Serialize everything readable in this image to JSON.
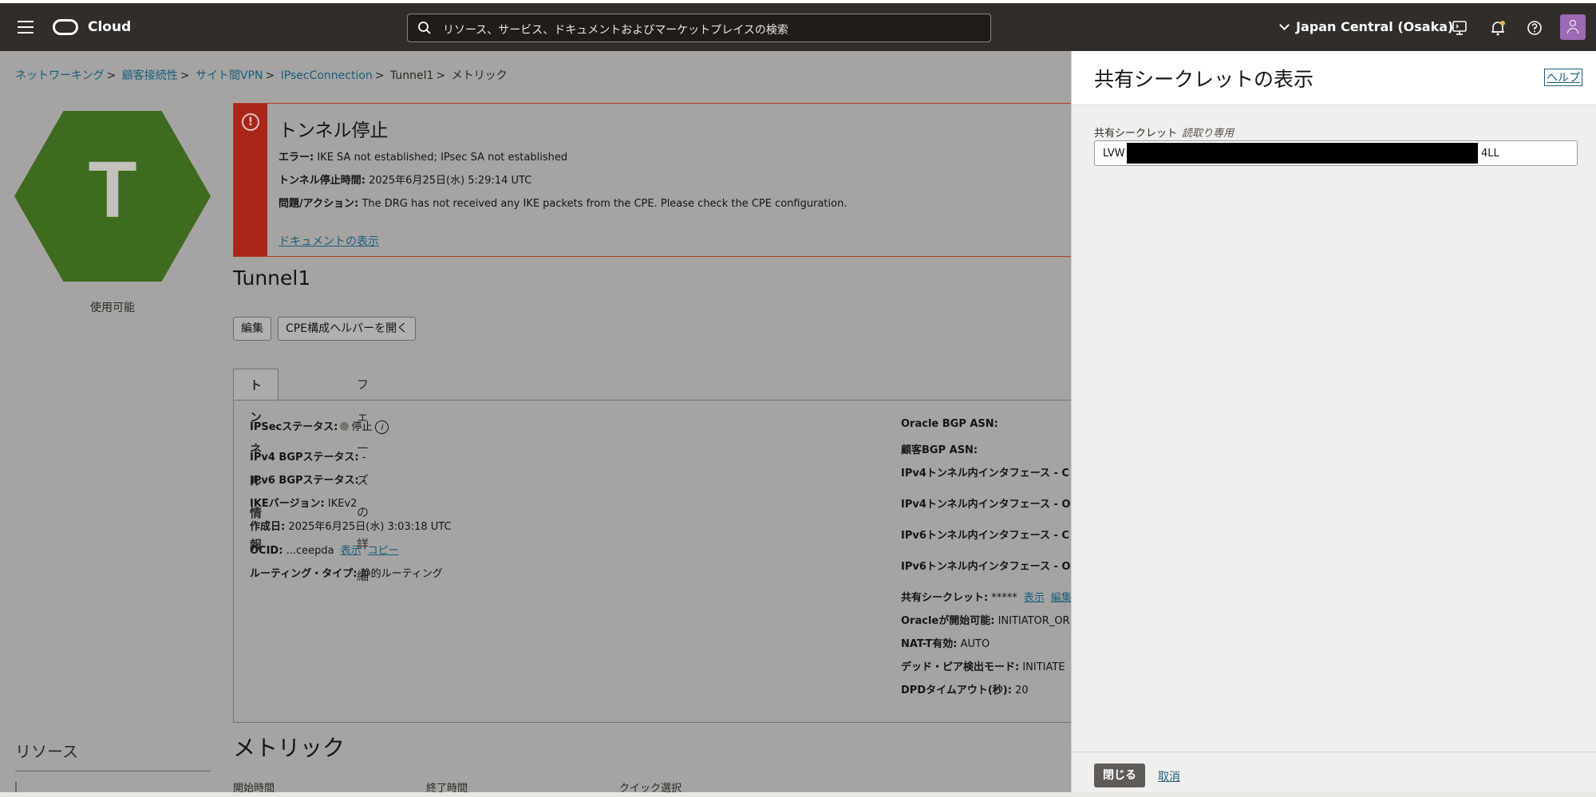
{
  "topbar": {
    "brand": "Cloud",
    "search_placeholder": "リソース、サービス、ドキュメントおよびマーケットプレイスの検索",
    "region": "Japan Central (Osaka)"
  },
  "breadcrumb": {
    "items": [
      "ネットワーキング",
      "顧客接続性",
      "サイト間VPN",
      "IPsecConnection",
      "Tunnel1"
    ],
    "current": "メトリック"
  },
  "resource_icon": {
    "letter": "T",
    "status": "使用可能"
  },
  "alert": {
    "title": "トンネル停止",
    "error_label": "エラー:",
    "error_value": "IKE SA not established; IPsec SA not established",
    "down_time_label": "トンネル停止時間:",
    "down_time_value": "2025年6月25日(水) 5:29:14 UTC",
    "issue_label": "問題/アクション:",
    "issue_value": "The DRG has not received any IKE packets from the CPE. Please check the CPE configuration.",
    "doc_link": "ドキュメントの表示"
  },
  "tunnel": {
    "title": "Tunnel1",
    "edit_label": "編集",
    "cpe_helper_label": "CPE構成ヘルパーを開く",
    "tabs": [
      "トンネル情報",
      "フェーズの詳細"
    ]
  },
  "info_left": {
    "ipsec_status_label": "IPSecステータス:",
    "ipsec_status_value": "停止",
    "ipv4_bgp_label": "IPv4 BGPステータス:",
    "ipv4_bgp_value": "-",
    "ipv6_bgp_label": "IPv6 BGPステータス:",
    "ipv6_bgp_value": "-",
    "ike_label": "IKEバージョン:",
    "ike_value": "IKEv2",
    "created_label": "作成日:",
    "created_value": "2025年6月25日(水) 3:03:18 UTC",
    "ocid_label": "OCID:",
    "ocid_value": "...ceepda",
    "ocid_show": "表示",
    "ocid_copy": "コピー",
    "routing_label": "ルーティング・タイプ:",
    "routing_value": "静的ルーティング"
  },
  "info_right": {
    "oracle_bgp_asn": "Oracle BGP ASN:",
    "customer_bgp_asn": "顧客BGP ASN:",
    "ipv4_if_c": "IPv4トンネル内インタフェース - C",
    "ipv4_if_o": "IPv4トンネル内インタフェース - O",
    "ipv6_if_c": "IPv6トンネル内インタフェース - C",
    "ipv6_if_o": "IPv6トンネル内インタフェース - O",
    "shared_secret_label": "共有シークレット:",
    "shared_secret_value": "*****",
    "shared_secret_show": "表示",
    "shared_secret_edit": "編集",
    "oracle_init_label": "Oracleが開始可能:",
    "oracle_init_value": "INITIATOR_OR",
    "natt_label": "NAT-T有効:",
    "natt_value": "AUTO",
    "dpd_mode_label": "デッド・ピア検出モード:",
    "dpd_mode_value": "INITIATE",
    "dpd_timeout_label": "DPDタイムアウト(秒):",
    "dpd_timeout_value": "20"
  },
  "resources": {
    "title": "リソース"
  },
  "metrics": {
    "title": "メトリック",
    "start_label": "開始時間",
    "end_label": "終了時間",
    "quick_label": "クイック選択"
  },
  "drawer": {
    "title": "共有シークレットの表示",
    "help": "ヘルプ",
    "field_label": "共有シークレット",
    "field_note": "読取り専用",
    "field_prefix": "LVW",
    "field_suffix": "4LL",
    "close_label": "閉じる",
    "cancel_label": "取消"
  }
}
